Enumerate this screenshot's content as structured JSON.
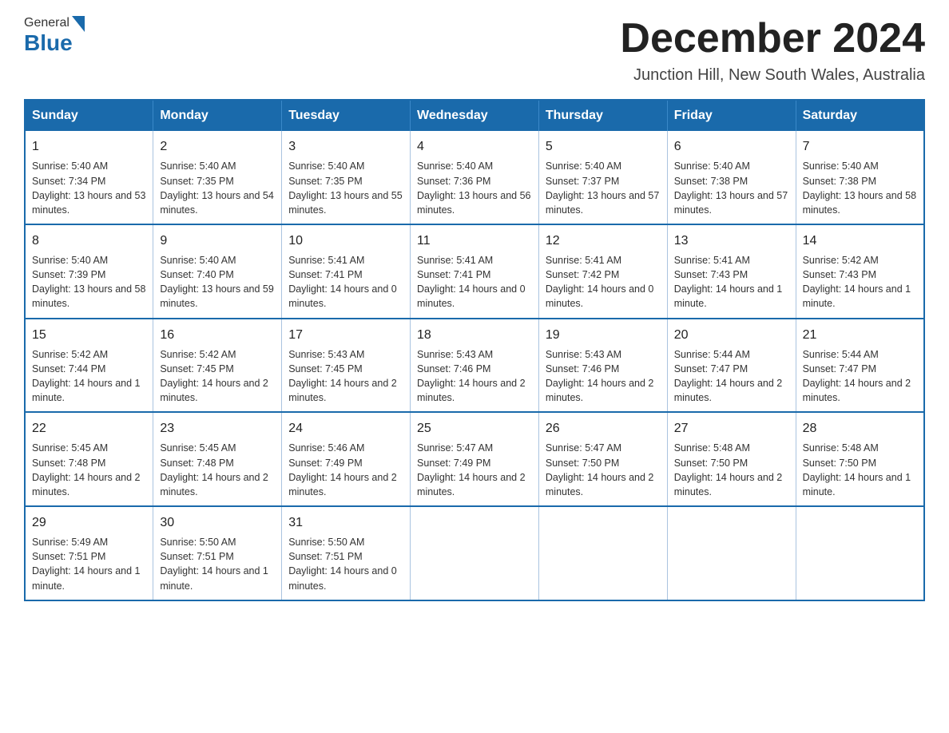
{
  "header": {
    "logo_general": "General",
    "logo_blue": "Blue",
    "month_title": "December 2024",
    "subtitle": "Junction Hill, New South Wales, Australia"
  },
  "days_of_week": [
    "Sunday",
    "Monday",
    "Tuesday",
    "Wednesday",
    "Thursday",
    "Friday",
    "Saturday"
  ],
  "weeks": [
    [
      {
        "day": "1",
        "sunrise": "5:40 AM",
        "sunset": "7:34 PM",
        "daylight": "13 hours and 53 minutes."
      },
      {
        "day": "2",
        "sunrise": "5:40 AM",
        "sunset": "7:35 PM",
        "daylight": "13 hours and 54 minutes."
      },
      {
        "day": "3",
        "sunrise": "5:40 AM",
        "sunset": "7:35 PM",
        "daylight": "13 hours and 55 minutes."
      },
      {
        "day": "4",
        "sunrise": "5:40 AM",
        "sunset": "7:36 PM",
        "daylight": "13 hours and 56 minutes."
      },
      {
        "day": "5",
        "sunrise": "5:40 AM",
        "sunset": "7:37 PM",
        "daylight": "13 hours and 57 minutes."
      },
      {
        "day": "6",
        "sunrise": "5:40 AM",
        "sunset": "7:38 PM",
        "daylight": "13 hours and 57 minutes."
      },
      {
        "day": "7",
        "sunrise": "5:40 AM",
        "sunset": "7:38 PM",
        "daylight": "13 hours and 58 minutes."
      }
    ],
    [
      {
        "day": "8",
        "sunrise": "5:40 AM",
        "sunset": "7:39 PM",
        "daylight": "13 hours and 58 minutes."
      },
      {
        "day": "9",
        "sunrise": "5:40 AM",
        "sunset": "7:40 PM",
        "daylight": "13 hours and 59 minutes."
      },
      {
        "day": "10",
        "sunrise": "5:41 AM",
        "sunset": "7:41 PM",
        "daylight": "14 hours and 0 minutes."
      },
      {
        "day": "11",
        "sunrise": "5:41 AM",
        "sunset": "7:41 PM",
        "daylight": "14 hours and 0 minutes."
      },
      {
        "day": "12",
        "sunrise": "5:41 AM",
        "sunset": "7:42 PM",
        "daylight": "14 hours and 0 minutes."
      },
      {
        "day": "13",
        "sunrise": "5:41 AM",
        "sunset": "7:43 PM",
        "daylight": "14 hours and 1 minute."
      },
      {
        "day": "14",
        "sunrise": "5:42 AM",
        "sunset": "7:43 PM",
        "daylight": "14 hours and 1 minute."
      }
    ],
    [
      {
        "day": "15",
        "sunrise": "5:42 AM",
        "sunset": "7:44 PM",
        "daylight": "14 hours and 1 minute."
      },
      {
        "day": "16",
        "sunrise": "5:42 AM",
        "sunset": "7:45 PM",
        "daylight": "14 hours and 2 minutes."
      },
      {
        "day": "17",
        "sunrise": "5:43 AM",
        "sunset": "7:45 PM",
        "daylight": "14 hours and 2 minutes."
      },
      {
        "day": "18",
        "sunrise": "5:43 AM",
        "sunset": "7:46 PM",
        "daylight": "14 hours and 2 minutes."
      },
      {
        "day": "19",
        "sunrise": "5:43 AM",
        "sunset": "7:46 PM",
        "daylight": "14 hours and 2 minutes."
      },
      {
        "day": "20",
        "sunrise": "5:44 AM",
        "sunset": "7:47 PM",
        "daylight": "14 hours and 2 minutes."
      },
      {
        "day": "21",
        "sunrise": "5:44 AM",
        "sunset": "7:47 PM",
        "daylight": "14 hours and 2 minutes."
      }
    ],
    [
      {
        "day": "22",
        "sunrise": "5:45 AM",
        "sunset": "7:48 PM",
        "daylight": "14 hours and 2 minutes."
      },
      {
        "day": "23",
        "sunrise": "5:45 AM",
        "sunset": "7:48 PM",
        "daylight": "14 hours and 2 minutes."
      },
      {
        "day": "24",
        "sunrise": "5:46 AM",
        "sunset": "7:49 PM",
        "daylight": "14 hours and 2 minutes."
      },
      {
        "day": "25",
        "sunrise": "5:47 AM",
        "sunset": "7:49 PM",
        "daylight": "14 hours and 2 minutes."
      },
      {
        "day": "26",
        "sunrise": "5:47 AM",
        "sunset": "7:50 PM",
        "daylight": "14 hours and 2 minutes."
      },
      {
        "day": "27",
        "sunrise": "5:48 AM",
        "sunset": "7:50 PM",
        "daylight": "14 hours and 2 minutes."
      },
      {
        "day": "28",
        "sunrise": "5:48 AM",
        "sunset": "7:50 PM",
        "daylight": "14 hours and 1 minute."
      }
    ],
    [
      {
        "day": "29",
        "sunrise": "5:49 AM",
        "sunset": "7:51 PM",
        "daylight": "14 hours and 1 minute."
      },
      {
        "day": "30",
        "sunrise": "5:50 AM",
        "sunset": "7:51 PM",
        "daylight": "14 hours and 1 minute."
      },
      {
        "day": "31",
        "sunrise": "5:50 AM",
        "sunset": "7:51 PM",
        "daylight": "14 hours and 0 minutes."
      },
      null,
      null,
      null,
      null
    ]
  ]
}
